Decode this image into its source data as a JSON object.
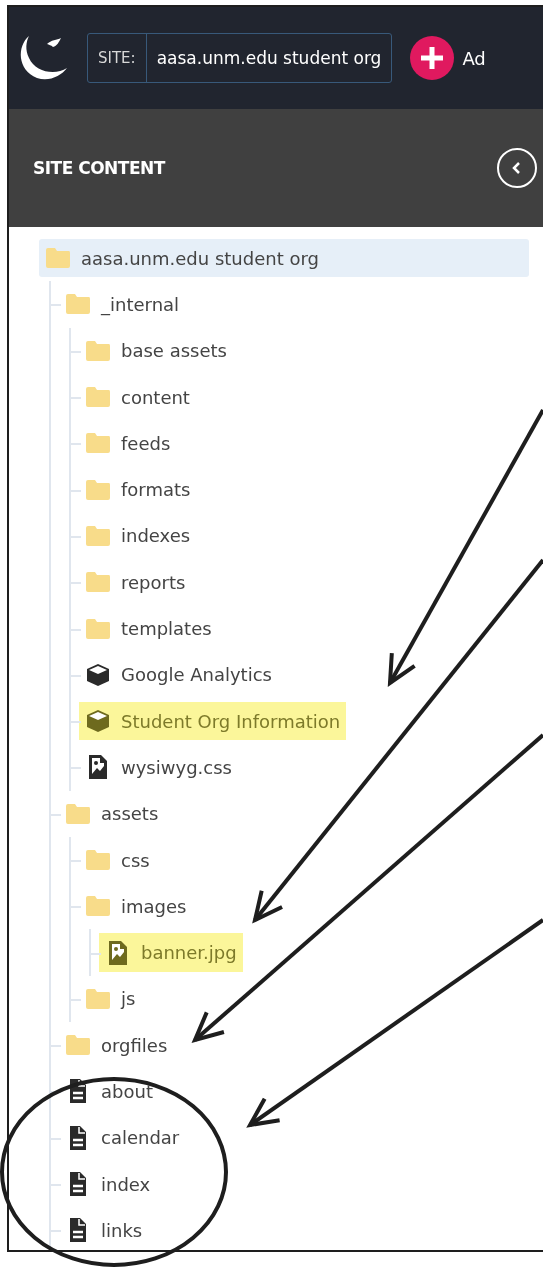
{
  "top_bar": {
    "site_label": "SITE:",
    "site_value": "aasa.unm.edu student org",
    "add_button": "Ad"
  },
  "panel": {
    "title": "SITE CONTENT"
  },
  "tree": [
    {
      "name": "aasa.unm.edu student org",
      "kind": "folder",
      "selected": true,
      "highlighted": false,
      "children": [
        {
          "name": "_internal",
          "kind": "folder",
          "selected": false,
          "highlighted": false,
          "children": [
            {
              "name": "base assets",
              "kind": "folder",
              "selected": false,
              "highlighted": false
            },
            {
              "name": "content",
              "kind": "folder",
              "selected": false,
              "highlighted": false
            },
            {
              "name": "feeds",
              "kind": "folder",
              "selected": false,
              "highlighted": false
            },
            {
              "name": "formats",
              "kind": "folder",
              "selected": false,
              "highlighted": false
            },
            {
              "name": "indexes",
              "kind": "folder",
              "selected": false,
              "highlighted": false
            },
            {
              "name": "reports",
              "kind": "folder",
              "selected": false,
              "highlighted": false
            },
            {
              "name": "templates",
              "kind": "folder",
              "selected": false,
              "highlighted": false
            },
            {
              "name": "Google Analytics",
              "kind": "block",
              "selected": false,
              "highlighted": false
            },
            {
              "name": "Student Org Information",
              "kind": "block",
              "selected": false,
              "highlighted": true
            },
            {
              "name": "wysiwyg.css",
              "kind": "file",
              "selected": false,
              "highlighted": false
            }
          ]
        },
        {
          "name": "assets",
          "kind": "folder",
          "selected": false,
          "highlighted": false,
          "children": [
            {
              "name": "css",
              "kind": "folder",
              "selected": false,
              "highlighted": false
            },
            {
              "name": "images",
              "kind": "folder",
              "selected": false,
              "highlighted": false,
              "children": [
                {
                  "name": "banner.jpg",
                  "kind": "file",
                  "selected": false,
                  "highlighted": true
                }
              ]
            },
            {
              "name": "js",
              "kind": "folder",
              "selected": false,
              "highlighted": false
            }
          ]
        },
        {
          "name": "orgfiles",
          "kind": "folder",
          "selected": false,
          "highlighted": false
        },
        {
          "name": "about",
          "kind": "page",
          "selected": false,
          "highlighted": false
        },
        {
          "name": "calendar",
          "kind": "page",
          "selected": false,
          "highlighted": false
        },
        {
          "name": "index",
          "kind": "page",
          "selected": false,
          "highlighted": false
        },
        {
          "name": "links",
          "kind": "page",
          "selected": false,
          "highlighted": false
        }
      ]
    }
  ]
}
